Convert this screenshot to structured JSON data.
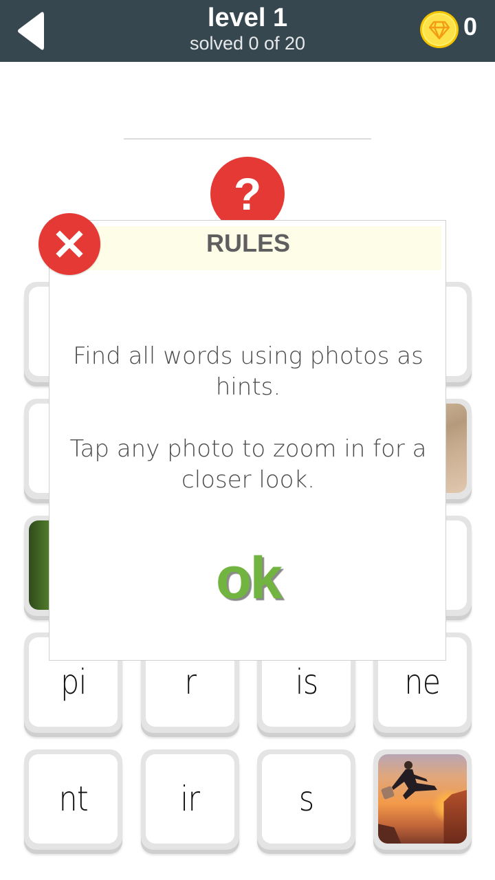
{
  "header": {
    "title": "level 1",
    "subtitle": "solved 0 of 20",
    "coins": "0",
    "back_icon": "back-arrow-icon",
    "coin_icon": "diamond-icon"
  },
  "hint_button": {
    "label": "?"
  },
  "tiles": [
    {
      "type": "blank"
    },
    {
      "type": "blank"
    },
    {
      "type": "blank"
    },
    {
      "type": "blank"
    },
    {
      "type": "blank"
    },
    {
      "type": "blank"
    },
    {
      "type": "blank"
    },
    {
      "type": "photo",
      "photo": "eye"
    },
    {
      "type": "photo",
      "photo": "tree-bark"
    },
    {
      "type": "blank"
    },
    {
      "type": "blank"
    },
    {
      "type": "blank"
    },
    {
      "type": "text",
      "text": "pi"
    },
    {
      "type": "text",
      "text": "r"
    },
    {
      "type": "text",
      "text": "is"
    },
    {
      "type": "text",
      "text": "ne"
    },
    {
      "type": "text",
      "text": "nt"
    },
    {
      "type": "text",
      "text": "ir"
    },
    {
      "type": "text",
      "text": "s"
    },
    {
      "type": "photo",
      "photo": "businesswoman-jumping-sunset"
    }
  ],
  "modal": {
    "title": "RULES",
    "paragraph1": "Find all words using photos as hints.",
    "paragraph2": "Tap any photo to zoom in for a closer look.",
    "ok_label": "ok",
    "close_icon": "close-icon"
  },
  "colors": {
    "header_bg": "#37474f",
    "accent_red": "#e53935",
    "ok_green": "#72b440",
    "coin_yellow": "#fde24a",
    "rules_header_bg": "#fdfde8"
  }
}
